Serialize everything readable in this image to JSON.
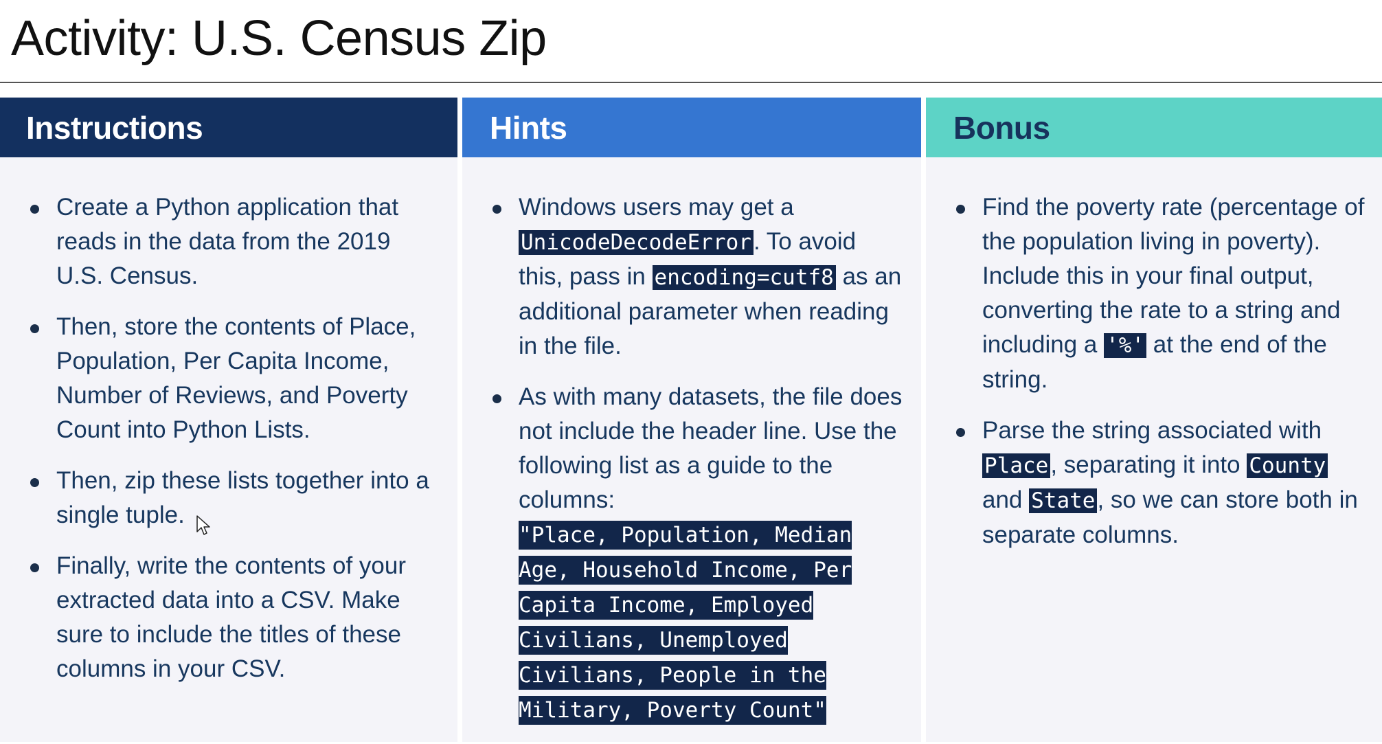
{
  "page": {
    "title": "Activity: U.S. Census Zip"
  },
  "instructions": {
    "header": "Instructions",
    "items": [
      "Create a Python application that reads in the data from the 2019 U.S. Census.",
      "Then, store the contents of Place, Population, Per Capita Income, Number of Reviews, and Poverty Count into Python Lists.",
      "Then, zip these lists together into a single tuple.",
      "Finally, write the contents of your extracted data into a CSV. Make sure to include the titles of these columns in your CSV."
    ]
  },
  "hints": {
    "header": "Hints",
    "item1": {
      "pre": "Windows users may get a ",
      "code1": "UnicodeDecodeError",
      "mid": ". To avoid this, pass in ",
      "code2": "encoding=cutf8",
      "post": " as an additional parameter when reading in the file."
    },
    "item2": {
      "text": "As with many datasets, the file does not include the header line. Use the following list as a guide to the columns:",
      "code": "\"Place, Population, Median Age, Household Income, Per Capita Income, Employed Civilians, Unemployed Civilians, People in the Military, Poverty Count\""
    }
  },
  "bonus": {
    "header": "Bonus",
    "item1": {
      "pre": "Find the poverty rate (percentage of the population living in poverty). Include this in your final output,  converting the rate to a string and including a ",
      "code": "'%'",
      "post": " at the end of the string."
    },
    "item2": {
      "pre": "Parse the string associated with ",
      "code1": "Place",
      "mid1": ", separating it into ",
      "code2": "County",
      "mid2": " and ",
      "code3": "State",
      "post": ", so we can store both in separate columns."
    }
  },
  "colors": {
    "instructions_header": "#13305f",
    "hints_header": "#3576d1",
    "bonus_header": "#5dd3c6",
    "code_background": "#12264a",
    "body_text": "#17375e"
  },
  "icons": {
    "cursor": "mouse-pointer-icon"
  }
}
